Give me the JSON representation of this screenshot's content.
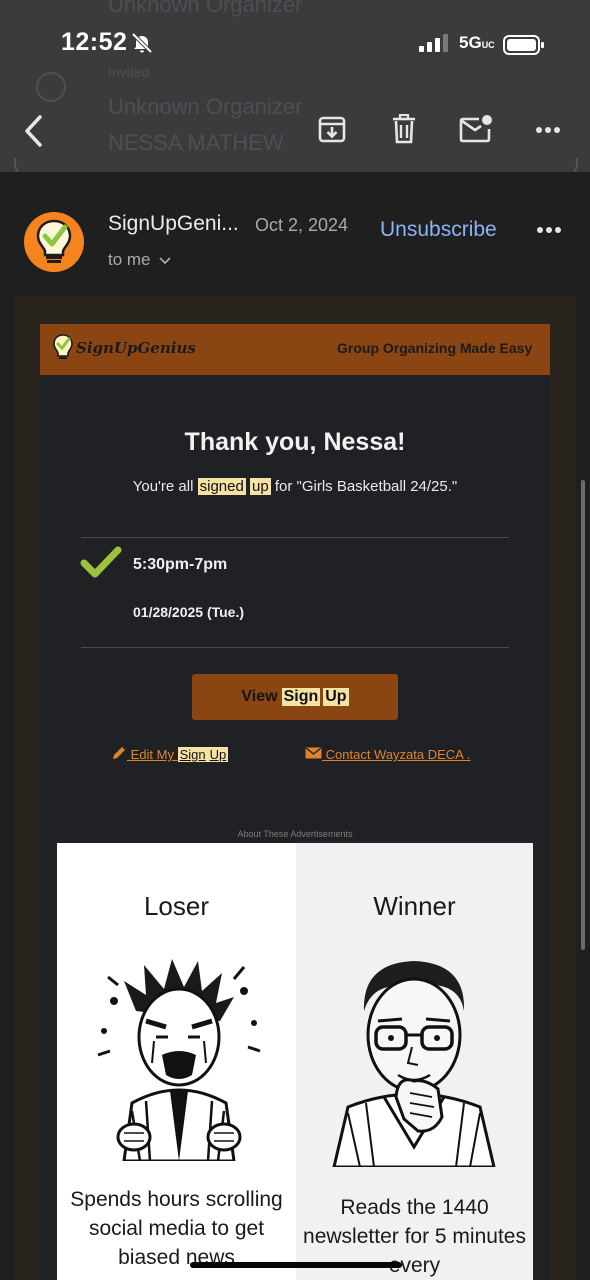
{
  "status": {
    "time": "12:52",
    "network": "5G",
    "network_sub": "UC"
  },
  "background_thread": {
    "line1": "Unknown Organizer",
    "line2": "Invited",
    "line3": "Unknown Organizer",
    "line4": "NESSA MATHEW"
  },
  "toolbar": {
    "back_icon": "back-arrow-icon",
    "archive_icon": "archive-icon",
    "delete_icon": "trash-icon",
    "unread_icon": "mark-unread-icon",
    "more_icon": "more-icon"
  },
  "message": {
    "sender": "SignUpGeni...",
    "date": "Oct 2, 2024",
    "recipient": "to me",
    "unsubscribe": "Unsubscribe"
  },
  "email": {
    "brand": "SignUpGenius",
    "tagline": "Group Organizing Made Easy",
    "heading": "Thank you, Nessa!",
    "signed_pre": "You're all",
    "signed_w1": "signed",
    "signed_w2": "up",
    "signed_post": "for \"Girls Basketball 24/25.\"",
    "slot_time": "5:30pm-7pm",
    "slot_date": "01/28/2025 (Tue.)",
    "view_btn_pre": "View",
    "view_btn_w1": "Sign",
    "view_btn_w2": "Up",
    "edit_pre": "Edit My",
    "edit_w1": "Sign",
    "edit_w2": "Up",
    "contact_link": "Contact Wayzata DECA ."
  },
  "ad": {
    "about": "About These Advertisements",
    "left_label": "Loser",
    "left_caption": "Spends hours scrolling social media to get biased news",
    "right_label": "Winner",
    "right_caption": "Reads the 1440 newsletter for 5 minutes every"
  },
  "colors": {
    "accent_blue": "#8ab4f8",
    "brand_brown": "#8b4513",
    "brand_orange": "#f5841f",
    "check_green": "#9dc33b",
    "link_orange": "#e0842b",
    "highlight": "#f6e3a4"
  }
}
